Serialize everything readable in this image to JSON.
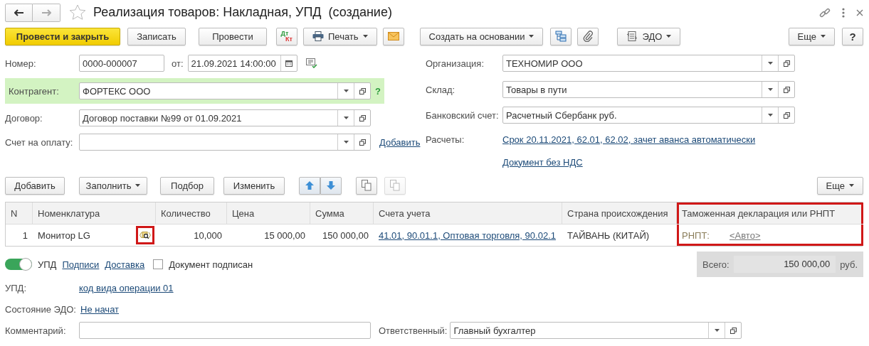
{
  "window": {
    "title": "Реализация товаров: Накладная, УПД  (создание)"
  },
  "toolbar": {
    "items": [
      {
        "kind": "primary",
        "label": "Провести и закрыть"
      },
      {
        "kind": "button",
        "label": "Записать"
      },
      {
        "kind": "button",
        "label": "Провести"
      },
      {
        "kind": "dtkt",
        "label": "Дт"
      },
      {
        "kind": "print",
        "label": "Печать"
      },
      {
        "kind": "mail"
      },
      {
        "kind": "menu",
        "label": "Создать на основании"
      },
      {
        "kind": "structure"
      },
      {
        "kind": "clip"
      },
      {
        "kind": "edo",
        "label": "ЭДО"
      }
    ],
    "more": "Еще",
    "help": "?"
  },
  "dtkt_sub": "Кт",
  "form": {
    "number": {
      "label": "Номер:",
      "value": "0000-000007"
    },
    "date": {
      "label": "от:",
      "value": "21.09.2021 14:00:00"
    },
    "counterparty": {
      "label": "Контрагент:",
      "value": "ФОРТЕКС ООО",
      "highlighted": true,
      "help": "?"
    },
    "contract": {
      "label": "Договор:",
      "value": "Договор поставки №99 от 01.09.2021"
    },
    "invoice": {
      "label": "Счет на оплату:",
      "link": "Добавить"
    },
    "organization": {
      "label": "Организация:",
      "value": "ТЕХНОМИР ООО"
    },
    "warehouse": {
      "label": "Склад:",
      "value": "Товары в пути"
    },
    "bank_account": {
      "label": "Банковский счет:",
      "value": "Расчетный Сбербанк руб."
    },
    "settlements": {
      "label": "Расчеты:",
      "link": "Срок 20.11.2021, 62.01, 62.02, зачет аванса автоматически"
    },
    "vat_link": "Документ без НДС"
  },
  "table_toolbar": {
    "items": [
      {
        "kind": "button",
        "label": "Добавить"
      },
      {
        "kind": "menu",
        "label": "Заполнить"
      },
      {
        "kind": "button",
        "label": "Подбор"
      },
      {
        "kind": "button",
        "label": "Изменить"
      },
      {
        "kind": "up"
      },
      {
        "kind": "down"
      },
      {
        "kind": "copy",
        "disabled": false
      },
      {
        "kind": "paste",
        "disabled": true
      }
    ],
    "more": "Еще"
  },
  "table": {
    "columns": [
      {
        "label": "N",
        "highlighted": false
      },
      {
        "label": "Номенклатура",
        "highlighted": false
      },
      {
        "label": "Количество",
        "highlighted": false
      },
      {
        "label": "Цена",
        "highlighted": false
      },
      {
        "label": "Сумма",
        "highlighted": false
      },
      {
        "label": "Счета учета",
        "highlighted": false
      },
      {
        "label": "Страна происхождения",
        "highlighted": false
      },
      {
        "label": "Таможенная декларация или РНПТ",
        "highlighted": true
      }
    ],
    "rows": [
      {
        "n": "1",
        "name": "Монитор LG",
        "icon_highlighted": true,
        "quantity": "10,000",
        "price": "15 000,00",
        "sum": "150 000,00",
        "accounts": "41.01, 90.01.1, Оптовая торговля, 90.02.1",
        "country": "ТАЙВАНЬ (КИТАЙ)",
        "customs_label": "РНПТ:",
        "customs_value": "<Авто>"
      }
    ]
  },
  "footer": {
    "upd_toggle": {
      "label": "УПД",
      "on": true
    },
    "links": [
      "Подписи",
      "Доставка"
    ],
    "signed": {
      "label": "Документ подписан",
      "checked": false
    },
    "total": {
      "label": "Всего:",
      "value": "150 000,00",
      "currency": "руб."
    },
    "upd": {
      "label": "УПД:",
      "link": "код вида операции 01"
    },
    "edo_state": {
      "label": "Состояние ЭДО:",
      "link": "Не начат"
    },
    "comment": {
      "label": "Комментарий:"
    },
    "responsible": {
      "label": "Ответственный:",
      "value": "Главный бухгалтер"
    }
  }
}
